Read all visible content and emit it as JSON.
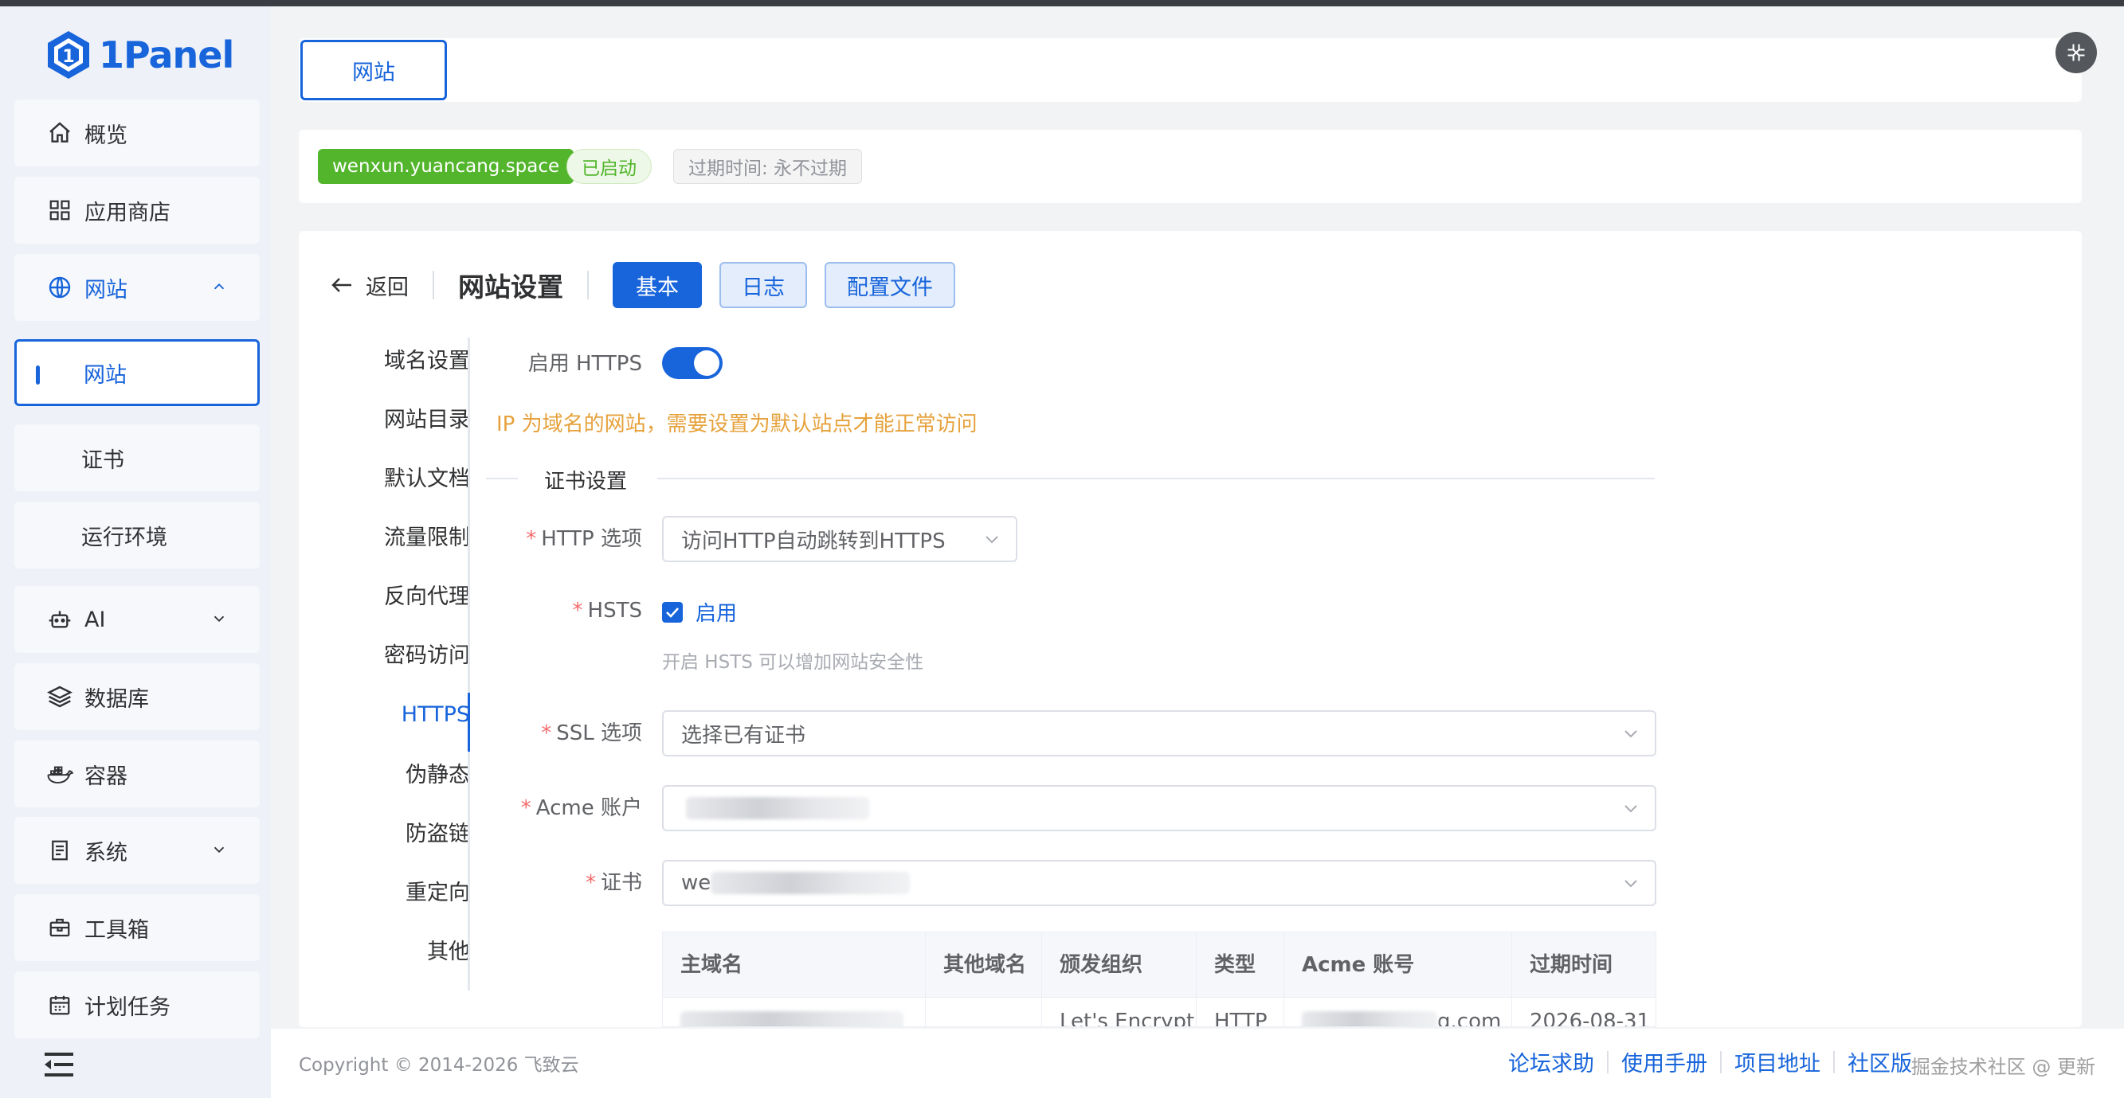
{
  "app": {
    "name": "1Panel"
  },
  "sidebar": {
    "items": [
      {
        "label": "概览",
        "icon": "home-icon"
      },
      {
        "label": "应用商店",
        "icon": "grid-icon"
      },
      {
        "label": "网站",
        "icon": "globe-icon",
        "expanded": true
      },
      {
        "label": "网站",
        "active": true
      },
      {
        "label": "证书"
      },
      {
        "label": "运行环境"
      },
      {
        "label": "AI",
        "icon": "robot-icon"
      },
      {
        "label": "数据库",
        "icon": "layers-icon"
      },
      {
        "label": "容器",
        "icon": "docker-icon"
      },
      {
        "label": "系统",
        "icon": "server-icon"
      },
      {
        "label": "工具箱",
        "icon": "toolbox-icon"
      },
      {
        "label": "计划任务",
        "icon": "calendar-icon"
      }
    ]
  },
  "tabs": {
    "website": "网站"
  },
  "site": {
    "domain": "wenxun.yuancang.space",
    "status": "已启动",
    "expire": "过期时间: 永不过期"
  },
  "header": {
    "back": "返回",
    "title": "网站设置",
    "modes": [
      "基本",
      "日志",
      "配置文件"
    ]
  },
  "submenu": [
    "域名设置",
    "网站目录",
    "默认文档",
    "流量限制",
    "反向代理",
    "密码访问",
    "HTTPS",
    "伪静态",
    "防盗链",
    "重定向",
    "其他"
  ],
  "form": {
    "enable_https_label": "启用 HTTPS",
    "enable_https": true,
    "warning": "IP 为域名的网站，需要设置为默认站点才能正常访问",
    "section_title": "证书设置",
    "http_option_label": "HTTP 选项",
    "http_option_value": "访问HTTP自动跳转到HTTPS",
    "hsts_label": "HSTS",
    "hsts_checkbox": "启用",
    "hsts_hint": "开启 HSTS 可以增加网站安全性",
    "ssl_option_label": "SSL 选项",
    "ssl_option_value": "选择已有证书",
    "acme_label": "Acme 账户",
    "acme_value": "",
    "cert_label": "证书",
    "cert_value": "we"
  },
  "table": {
    "headers": [
      "主域名",
      "其他域名",
      "颁发组织",
      "类型",
      "Acme 账号",
      "过期时间"
    ],
    "row": [
      "",
      "",
      "Let's Encrypt",
      "HTTP",
      "g.com",
      "2026-08-31"
    ]
  },
  "footer": {
    "copyright": "Copyright © 2014-2026 飞致云",
    "links": [
      "论坛求助",
      "使用手册",
      "项目地址",
      "社区版"
    ],
    "watermark": "掘金技术社区 @ 更新"
  },
  "colors": {
    "accent": "#1764db",
    "success": "#52b52b",
    "warning": "#e6a23c",
    "danger": "#f56c6c"
  }
}
